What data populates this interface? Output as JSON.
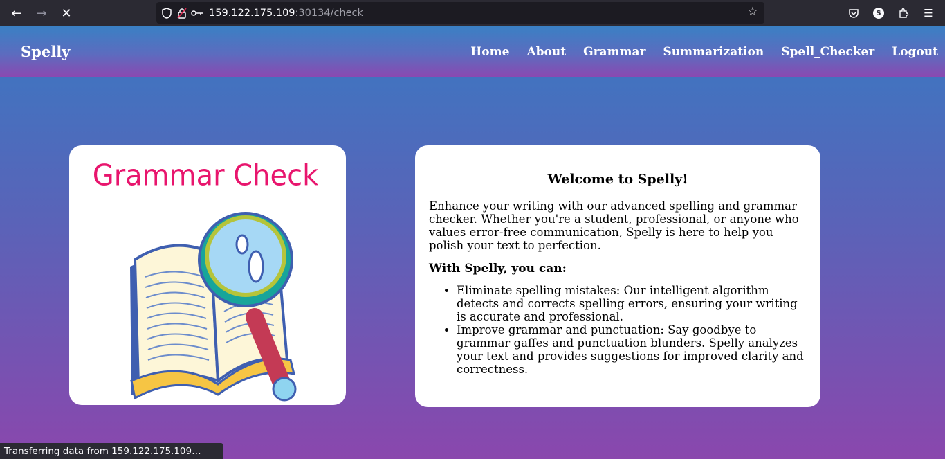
{
  "browser": {
    "url_host": "159.122.175.109",
    "url_path": ":30134/check",
    "account_initial": "S"
  },
  "site": {
    "brand": "Spelly",
    "nav": [
      "Home",
      "About",
      "Grammar",
      "Summarization",
      "Spell_Checker",
      "Logout"
    ]
  },
  "image_card": {
    "heading": "Grammar Check"
  },
  "welcome": {
    "title": "Welcome to Spelly!",
    "intro": "Enhance your writing with our advanced spelling and grammar checker. Whether you're a student, professional, or anyone who values error-free communication, Spelly is here to help you polish your text to perfection.",
    "subheading": "With Spelly, you can:",
    "features": [
      "Eliminate spelling mistakes: Our intelligent algorithm detects and corrects spelling errors, ensuring your writing is accurate and professional.",
      "Improve grammar and punctuation: Say goodbye to grammar gaffes and punctuation blunders. Spelly analyzes your text and provides suggestions for improved clarity and correctness."
    ]
  },
  "status_bar": "Transferring data from 159.122.175.109…",
  "colors": {
    "gradient_top": "#3a78c2",
    "gradient_bottom": "#8a47ad",
    "grammar_check_pink": "#e8156d"
  }
}
